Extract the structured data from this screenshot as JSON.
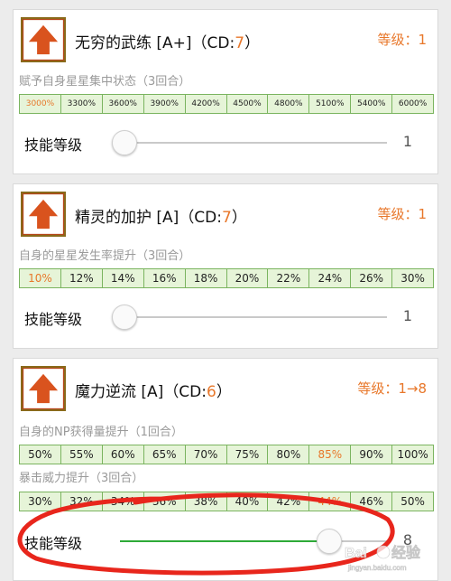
{
  "skills": [
    {
      "name": "无穷的武练 [A+]",
      "cd_prefix": "（CD:",
      "cd_value": "7",
      "cd_suffix": "）",
      "level_text": "等级：1",
      "icon": "sparkle-burst-icon",
      "effects": [
        {
          "label": "赋予自身星星集中状态（3回合）",
          "values": [
            "3000%",
            "3300%",
            "3600%",
            "3900%",
            "4200%",
            "4500%",
            "4800%",
            "5100%",
            "5400%",
            "6000%"
          ],
          "highlight_index": 0
        }
      ],
      "slider": {
        "label": "技能等级",
        "value": "1",
        "fraction": 0.0
      }
    },
    {
      "name": "精灵的加护 [A]",
      "cd_prefix": "（CD:",
      "cd_value": "7",
      "cd_suffix": "）",
      "level_text": "等级：1",
      "icon": "golden-orb-icon",
      "effects": [
        {
          "label": "自身的星星发生率提升（3回合）",
          "values": [
            "10%",
            "12%",
            "14%",
            "16%",
            "18%",
            "20%",
            "22%",
            "24%",
            "26%",
            "30%"
          ],
          "highlight_index": 0
        }
      ],
      "slider": {
        "label": "技能等级",
        "value": "1",
        "fraction": 0.0
      }
    },
    {
      "name": "魔力逆流 [A]",
      "cd_prefix": "（CD:",
      "cd_value": "6",
      "cd_suffix": "）",
      "level_text": "等级：1→8",
      "icon": "sword-icon",
      "effects": [
        {
          "label": "自身的NP获得量提升（1回合）",
          "values": [
            "50%",
            "55%",
            "60%",
            "65%",
            "70%",
            "75%",
            "80%",
            "85%",
            "90%",
            "100%"
          ],
          "highlight_index": 7
        },
        {
          "label": "暴击威力提升（3回合）",
          "values": [
            "30%",
            "32%",
            "34%",
            "36%",
            "38%",
            "40%",
            "42%",
            "44%",
            "46%",
            "50%"
          ],
          "highlight_index": 7
        }
      ],
      "slider": {
        "label": "技能等级",
        "value": "8",
        "fraction": 0.78
      }
    }
  ],
  "colors": {
    "accent_orange": "#e8772a",
    "grid_fill": "#e6f4d8",
    "grid_border": "#7ab45f",
    "slider_fill": "#2eaa38",
    "annotation_red": "#e8261c"
  },
  "watermark": "Baidu 经验"
}
